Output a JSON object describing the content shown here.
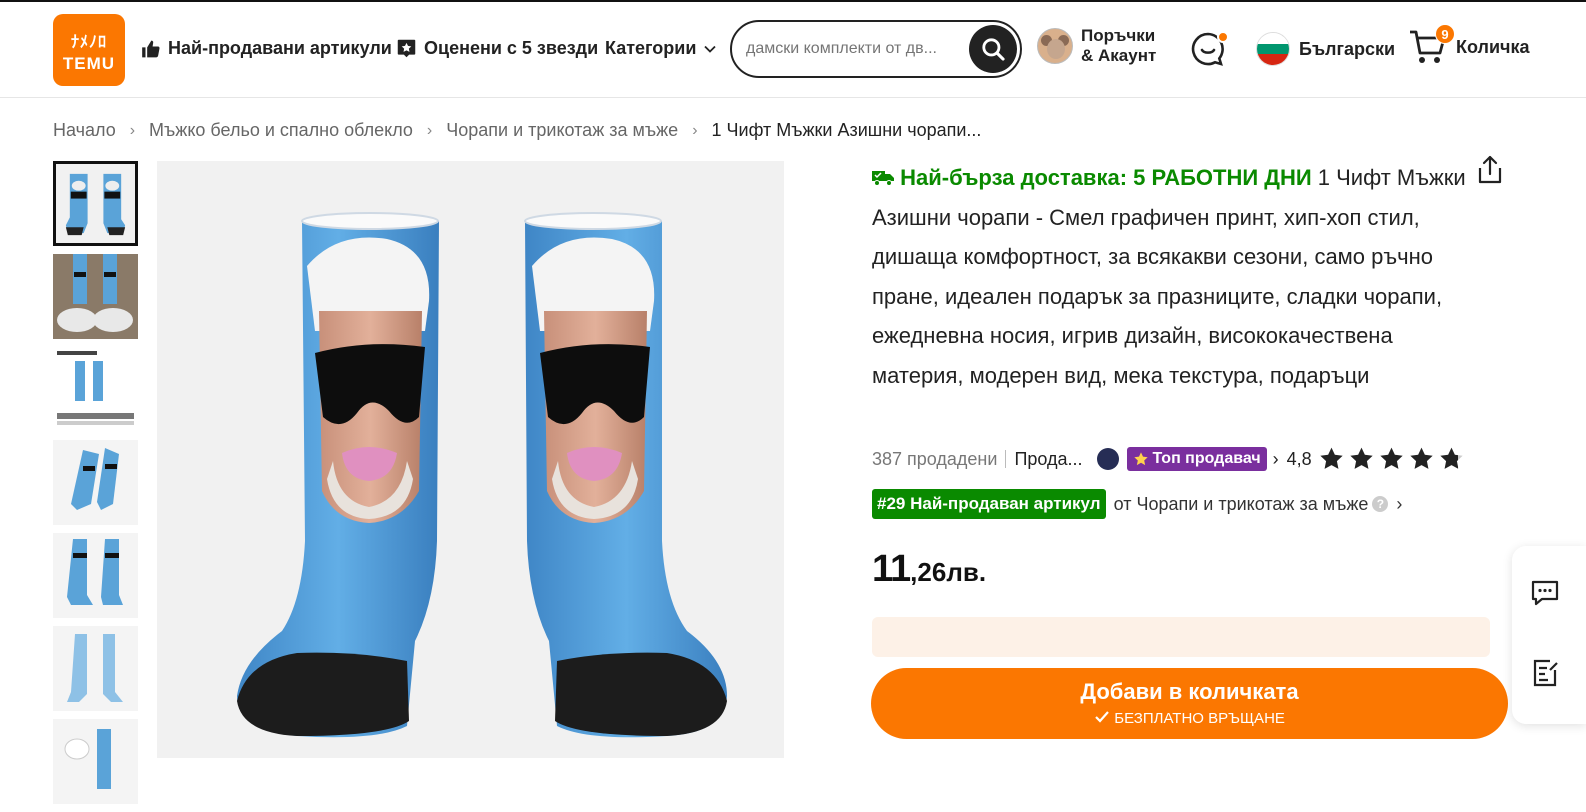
{
  "header": {
    "logo_glyphs": "ﾅﾒﾉﾛ",
    "logo_text": "TEMU",
    "nav": {
      "bestsellers": "Най-продавани артикули",
      "five_stars": "Оценени с 5 звезди",
      "categories": "Категории"
    },
    "search": {
      "placeholder": "дамски комплекти от дв..."
    },
    "account": {
      "line1": "Поръчки",
      "line2": "& Акаунт"
    },
    "language": "Български",
    "cart": {
      "label": "Количка",
      "count": "9"
    }
  },
  "breadcrumb": {
    "items": [
      "Начало",
      "Мъжко бельо и спално облекло",
      "Чорапи и трикотаж за мъже"
    ],
    "current": "1 Чифт Мъжки Азишни чорапи..."
  },
  "product": {
    "fast_delivery": "Най-бърза доставка: 5 РАБОТНИ ДНИ",
    "title": "1 Чифт Мъжки Азишни чорапи - Смел графичен принт, хип-хоп стил, дишаща комфортност, за всякакви сезони, само ръчно пране, идеален подарък за празниците, сладки чорапи, ежедневна носия, игрив дизайн, висококачествена материя, модерен вид, мека текстура, подаръци",
    "sold": "387 продадени",
    "seller": "Прода...",
    "top_seller_badge": "Топ продавач",
    "rating": "4,8",
    "stars": 4.8,
    "rank_badge": "#29 Най-продаван артикул",
    "rank_text": "от Чорапи и трикотаж за мъже",
    "price_int": "11",
    "price_frac": ",26лв.",
    "add_to_cart": "Добави в количката",
    "free_return": "БЕЗПЛАТНО ВРЪЩАНЕ"
  },
  "colors": {
    "brand": "#fb7701",
    "fast_delivery": "#0a8a00",
    "top_seller": "#7a2f9e",
    "rank_badge": "#0a8a00"
  },
  "icons": [
    "thumbs-up-icon",
    "star-badge-icon",
    "chevron-down-icon",
    "search-icon",
    "chat-icon",
    "cart-icon",
    "share-icon",
    "message-icon",
    "checklist-icon"
  ]
}
